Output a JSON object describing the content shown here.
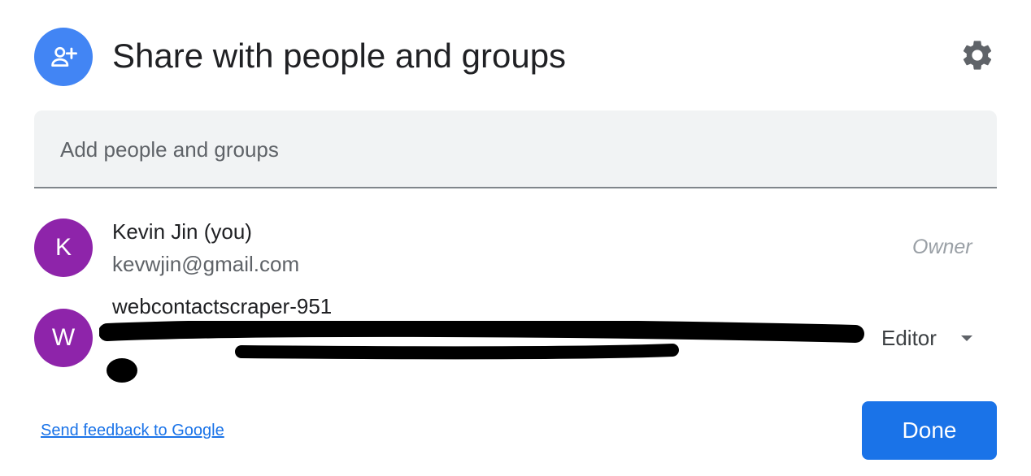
{
  "dialog": {
    "title": "Share with people and groups",
    "header_icon": "person-add-icon",
    "settings_icon": "gear-icon"
  },
  "add_people": {
    "placeholder": "Add people and groups",
    "value": ""
  },
  "people": [
    {
      "initial": "K",
      "name": "Kevin Jin (you)",
      "email": "kevwjin@gmail.com",
      "role": "Owner",
      "avatar_color": "#8e24aa"
    },
    {
      "initial": "W",
      "name": "webcontactscraper-951",
      "role": "Editor",
      "avatar_color": "#8e24aa"
    }
  ],
  "footer": {
    "feedback_link": "Send feedback to Google",
    "done_label": "Done"
  },
  "colors": {
    "accent": "#1a73e8",
    "header_icon_bg": "#4285f4",
    "avatar": "#8e24aa"
  }
}
